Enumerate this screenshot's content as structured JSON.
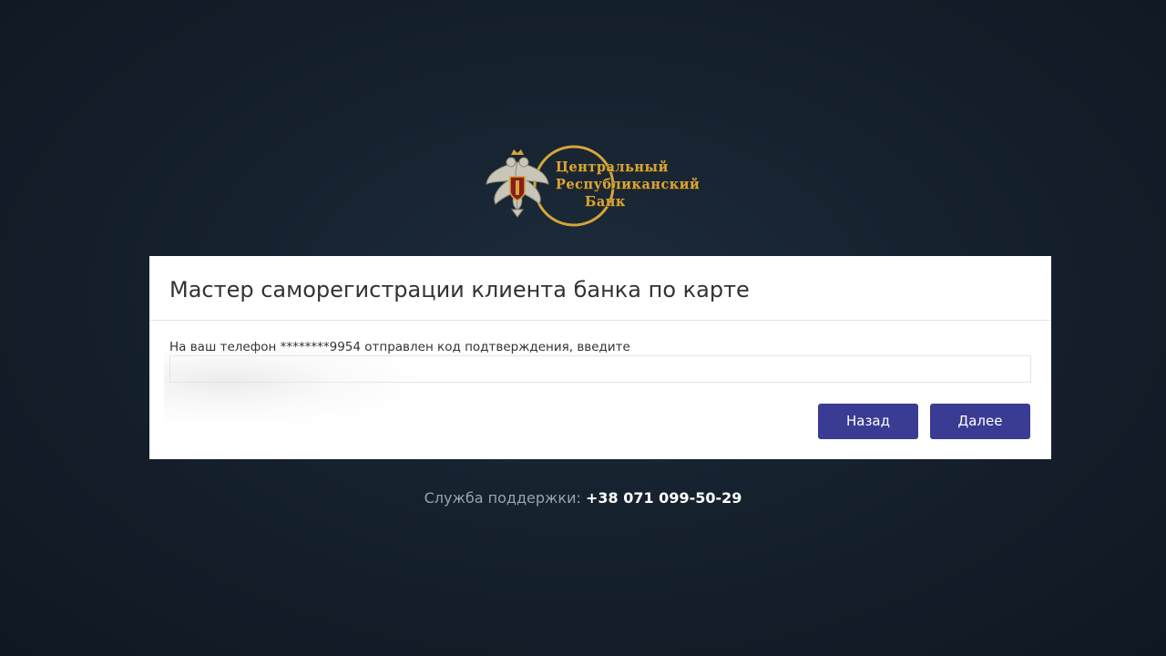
{
  "logo": {
    "line1": "Центральный",
    "line2": "Республиканский",
    "line3": "Банк",
    "emblem_icon": "double-headed-eagle-coat-of-arms",
    "gold_color": "#d4a53a"
  },
  "wizard": {
    "title": "Мастер саморегистрации клиента банка по карте",
    "instruction": "На ваш телефон ********9954 отправлен код подтверждения, введите",
    "code_value": "",
    "code_placeholder": "",
    "back_label": "Назад",
    "next_label": "Далее",
    "button_color": "#3a3b93"
  },
  "support": {
    "label": "Служба поддержки:",
    "phone": "+38 071 099-50-29"
  }
}
